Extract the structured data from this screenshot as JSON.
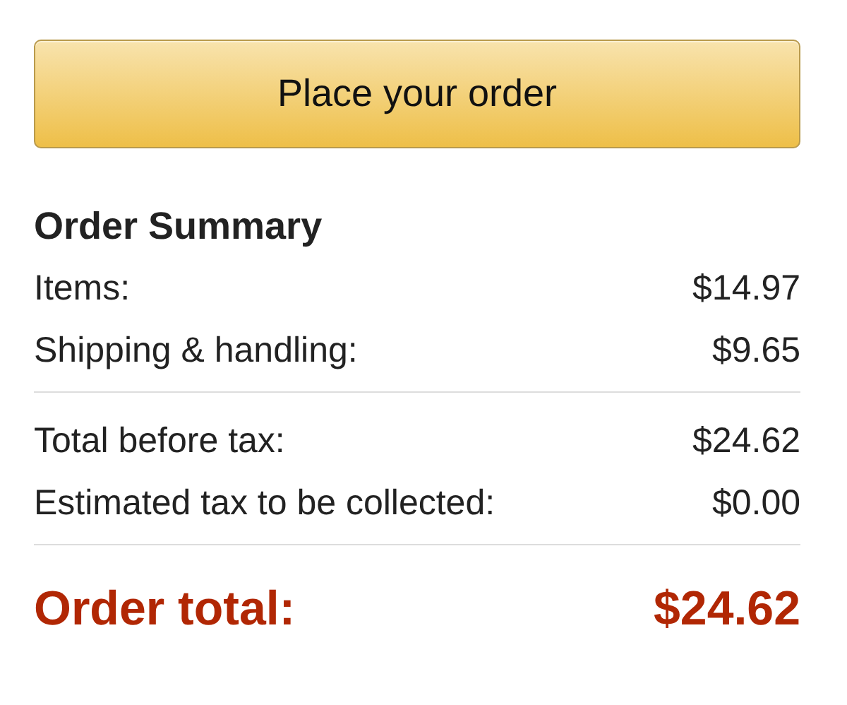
{
  "button": {
    "label": "Place your order"
  },
  "summary": {
    "title": "Order Summary",
    "groups": [
      [
        {
          "label": "Items:",
          "amount": "$14.97"
        },
        {
          "label": "Shipping & handling:",
          "amount": "$9.65"
        }
      ],
      [
        {
          "label": "Total before tax:",
          "amount": "$24.62"
        },
        {
          "label": "Estimated tax to be collected:",
          "amount": "$0.00"
        }
      ]
    ],
    "total": {
      "label": "Order total:",
      "amount": "$24.62"
    }
  }
}
